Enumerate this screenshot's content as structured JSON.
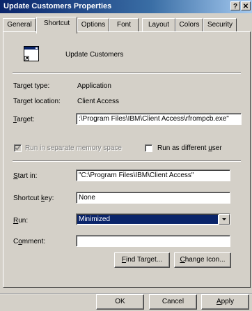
{
  "window": {
    "title": "Update Customers Properties",
    "help_label": "?",
    "close_label": "✕"
  },
  "tabs": [
    {
      "label": "General",
      "active": false
    },
    {
      "label": "Shortcut",
      "active": true
    },
    {
      "label": "Options",
      "active": false
    },
    {
      "label": "Font",
      "active": false
    },
    {
      "label": "Layout",
      "active": false
    },
    {
      "label": "Colors",
      "active": false
    },
    {
      "label": "Security",
      "active": false
    }
  ],
  "shortcut": {
    "name": "Update Customers",
    "icon": "window-app-icon",
    "target_type_label": "Target type:",
    "target_type_value": "Application",
    "target_location_label": "Target location:",
    "target_location_value": "Client Access",
    "target_label": "Target:",
    "target_value": ":\\Program Files\\IBM\\Client Access\\rfrompcb.exe\"",
    "run_separate_label": "Run in separate memory space",
    "run_separate_checked": true,
    "run_separate_enabled": false,
    "run_different_user_label": "Run as different user",
    "run_different_user_checked": false,
    "start_in_label": "Start in:",
    "start_in_value": "\"C:\\Program Files\\IBM\\Client Access\"",
    "shortcut_key_label": "Shortcut key:",
    "shortcut_key_value": "None",
    "run_label": "Run:",
    "run_value": "Minimized",
    "comment_label": "Comment:",
    "comment_value": "",
    "find_target_label": "Find Target...",
    "change_icon_label": "Change Icon..."
  },
  "footer": {
    "ok_label": "OK",
    "cancel_label": "Cancel",
    "apply_label": "Apply"
  }
}
